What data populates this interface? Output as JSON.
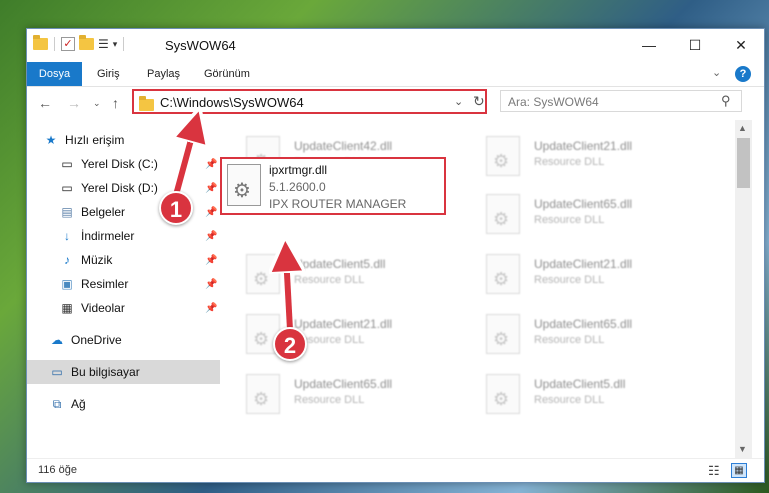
{
  "window": {
    "title": "SysWOW64",
    "controls": {
      "minimize": "—",
      "maximize": "☐",
      "close": "✕"
    }
  },
  "ribbon": {
    "tabs": [
      "Dosya",
      "Giriş",
      "Paylaş",
      "Görünüm"
    ],
    "help_label": "?"
  },
  "nav": {
    "address": "C:\\Windows\\SysWOW64",
    "search_placeholder": "Ara: SysWOW64"
  },
  "sidebar": {
    "items": [
      {
        "label": "Hızlı erişim"
      },
      {
        "label": "Yerel Disk (C:)"
      },
      {
        "label": "Yerel Disk (D:)"
      },
      {
        "label": "Belgeler"
      },
      {
        "label": "İndirmeler"
      },
      {
        "label": "Müzik"
      },
      {
        "label": "Resimler"
      },
      {
        "label": "Videolar"
      },
      {
        "label": "OneDrive"
      },
      {
        "label": "Bu bilgisayar"
      },
      {
        "label": "Ağ"
      }
    ]
  },
  "files": [
    {
      "name": "UpdateClient42.dll",
      "type": "Resource DLL"
    },
    {
      "name": "UpdateClient21.dll",
      "type": "Resource DLL"
    },
    {
      "name": "UpdateClient65.dll",
      "type": "Resource DLL"
    },
    {
      "name": "UpdateClient5.dll",
      "type": "Resource DLL"
    },
    {
      "name": "UpdateClient21.dll",
      "type": "Resource DLL"
    },
    {
      "name": "UpdateClient21.dll",
      "type": "Resource DLL"
    },
    {
      "name": "UpdateClient65.dll",
      "type": "Resource DLL"
    },
    {
      "name": "UpdateClient65.dll",
      "type": "Resource DLL"
    },
    {
      "name": "UpdateClient5.dll",
      "type": "Resource DLL"
    }
  ],
  "highlighted_file": {
    "name": "ipxrtmgr.dll",
    "version": "5.1.2600.0",
    "description": "IPX ROUTER MANAGER"
  },
  "status": {
    "item_count": "116 öğe"
  },
  "callouts": {
    "one": "1",
    "two": "2"
  },
  "colors": {
    "accent": "#1979ca",
    "highlight": "#d9343f"
  }
}
